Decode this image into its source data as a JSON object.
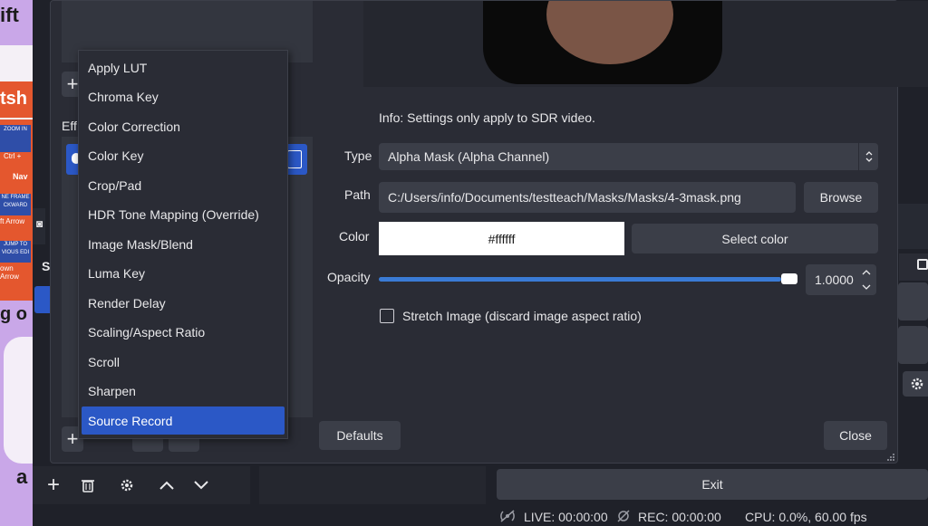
{
  "background_app": {
    "text_fragments": [
      "ift",
      "tsh",
      "ZOOM IN",
      "Ctrl +",
      "Nav",
      "NE FRAME CKWARD",
      "ft Arrow",
      "JUMP TO VIOUS EDI",
      "own Arrow",
      "g o",
      "a"
    ]
  },
  "filters_dialog": {
    "effects_label": "Eff",
    "info_text": "Info: Settings only apply to SDR video.",
    "type_label": "Type",
    "type_value": "Alpha Mask (Alpha Channel)",
    "path_label": "Path",
    "path_value": "C:/Users/info/Documents/testteach/Masks/Masks/4-3mask.png",
    "browse_label": "Browse",
    "color_label": "Color",
    "color_value": "#ffffff",
    "select_color_label": "Select color",
    "opacity_label": "Opacity",
    "opacity_value": "1.0000",
    "opacity_level": 1.0,
    "stretch_label": "Stretch Image (discard image aspect ratio)",
    "stretch_checked": false,
    "defaults_label": "Defaults",
    "close_label": "Close"
  },
  "filter_menu": {
    "items": [
      "Apply LUT",
      "Chroma Key",
      "Color Correction",
      "Color Key",
      "Crop/Pad",
      "HDR Tone Mapping (Override)",
      "Image Mask/Blend",
      "Luma Key",
      "Render Delay",
      "Scaling/Aspect Ratio",
      "Scroll",
      "Sharpen",
      "Source Record"
    ],
    "selected": "Source Record"
  },
  "main_window": {
    "sources_partial_label": "S",
    "exit_label": "Exit",
    "status": {
      "live": "LIVE: 00:00:00",
      "rec": "REC: 00:00:00",
      "cpu": "CPU: 0.0%, 60.00 fps"
    }
  },
  "colors": {
    "accent_blue": "#2b58c6",
    "slider_blue": "#3a7bd5",
    "dialog_bg": "#2a2c35",
    "field_bg": "#3b3e48"
  }
}
